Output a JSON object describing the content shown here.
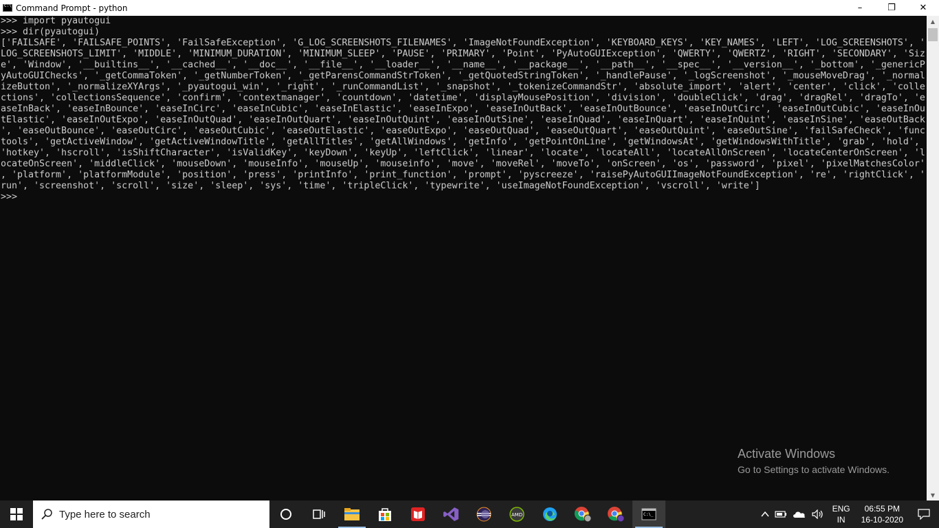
{
  "window": {
    "title": "Command Prompt - python",
    "minimize": "–",
    "restore": "❐",
    "close": "✕"
  },
  "console": {
    "lines": [
      ">>> import pyautogui",
      ">>> dir(pyautogui)",
      "['FAILSAFE', 'FAILSAFE_POINTS', 'FailSafeException', 'G_LOG_SCREENSHOTS_FILENAMES', 'ImageNotFoundException', 'KEYBOARD_KEYS', 'KEY_NAMES', 'LEFT', 'LOG_SCREENSHOTS', '",
      "LOG_SCREENSHOTS_LIMIT', 'MIDDLE', 'MINIMUM_DURATION', 'MINIMUM_SLEEP', 'PAUSE', 'PRIMARY', 'Point', 'PyAutoGUIException', 'QWERTY', 'QWERTZ', 'RIGHT', 'SECONDARY', 'Siz",
      "e', 'Window', '__builtins__', '__cached__', '__doc__', '__file__', '__loader__', '__name__', '__package__', '__path__', '__spec__', '__version__', '_bottom', '_genericP",
      "yAutoGUIChecks', '_getCommaToken', '_getNumberToken', '_getParensCommandStrToken', '_getQuotedStringToken', '_handlePause', '_logScreenshot', '_mouseMoveDrag', '_normal",
      "izeButton', '_normalizeXYArgs', '_pyautogui_win', '_right', '_runCommandList', '_snapshot', '_tokenizeCommandStr', 'absolute_import', 'alert', 'center', 'click', 'colle",
      "ctions', 'collectionsSequence', 'confirm', 'contextmanager', 'countdown', 'datetime', 'displayMousePosition', 'division', 'doubleClick', 'drag', 'dragRel', 'dragTo', 'e",
      "aseInBack', 'easeInBounce', 'easeInCirc', 'easeInCubic', 'easeInElastic', 'easeInExpo', 'easeInOutBack', 'easeInOutBounce', 'easeInOutCirc', 'easeInOutCubic', 'easeInOu",
      "tElastic', 'easeInOutExpo', 'easeInOutQuad', 'easeInOutQuart', 'easeInOutQuint', 'easeInOutSine', 'easeInQuad', 'easeInQuart', 'easeInQuint', 'easeInSine', 'easeOutBack",
      "', 'easeOutBounce', 'easeOutCirc', 'easeOutCubic', 'easeOutElastic', 'easeOutExpo', 'easeOutQuad', 'easeOutQuart', 'easeOutQuint', 'easeOutSine', 'failSafeCheck', 'func",
      "tools', 'getActiveWindow', 'getActiveWindowTitle', 'getAllTitles', 'getAllWindows', 'getInfo', 'getPointOnLine', 'getWindowsAt', 'getWindowsWithTitle', 'grab', 'hold',",
      "'hotkey', 'hscroll', 'isShiftCharacter', 'isValidKey', 'keyDown', 'keyUp', 'leftClick', 'linear', 'locate', 'locateAll', 'locateAllOnScreen', 'locateCenterOnScreen', 'l",
      "ocateOnScreen', 'middleClick', 'mouseDown', 'mouseInfo', 'mouseUp', 'mouseinfo', 'move', 'moveRel', 'moveTo', 'onScreen', 'os', 'password', 'pixel', 'pixelMatchesColor'",
      ", 'platform', 'platformModule', 'position', 'press', 'printInfo', 'print_function', 'prompt', 'pyscreeze', 'raisePyAutoGUIImageNotFoundException', 're', 'rightClick', '",
      "run', 'screenshot', 'scroll', 'size', 'sleep', 'sys', 'time', 'tripleClick', 'typewrite', 'useImageNotFoundException', 'vscroll', 'write']",
      ">>>"
    ]
  },
  "watermark": {
    "line1": "Activate Windows",
    "line2": "Go to Settings to activate Windows."
  },
  "taskbar": {
    "search_placeholder": "Type here to search",
    "lang_top": "ENG",
    "lang_bottom": "IN",
    "time": "06:55 PM",
    "date": "16-10-2020"
  }
}
